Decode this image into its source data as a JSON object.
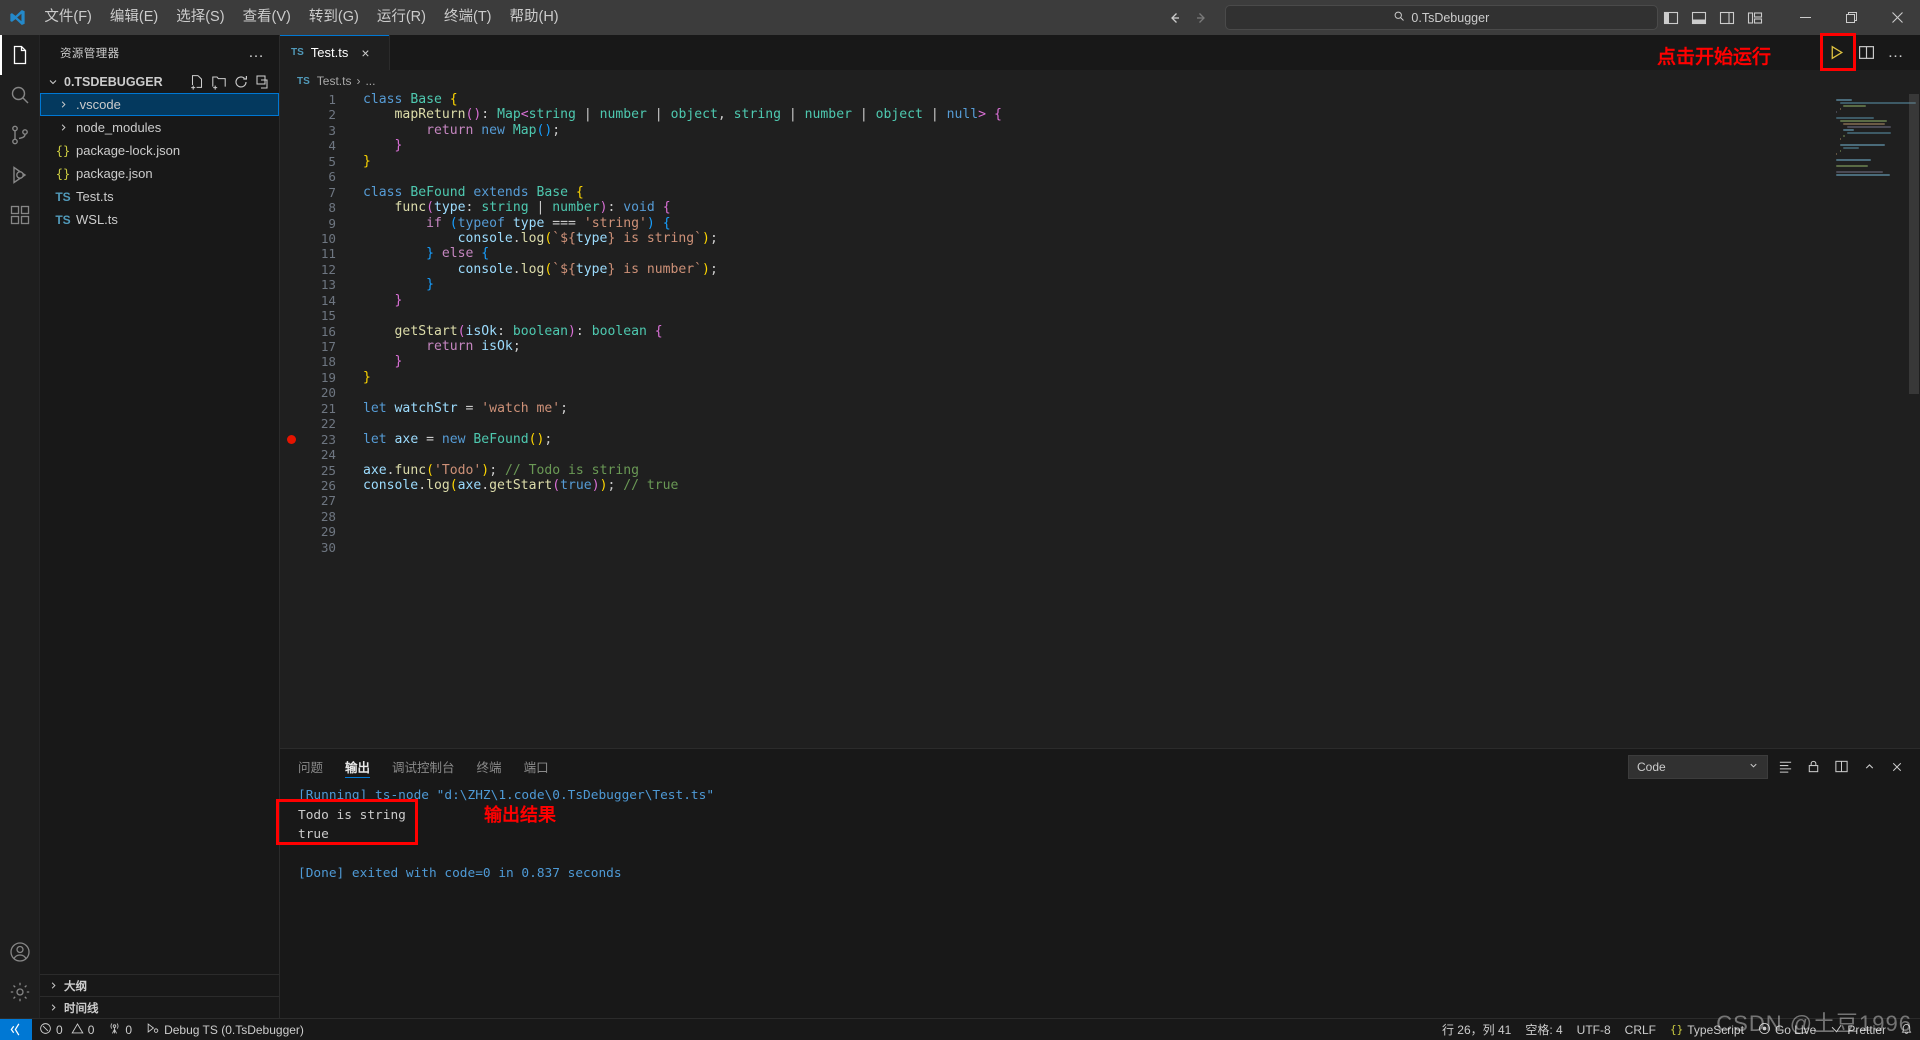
{
  "titlebar": {
    "menus": [
      "文件(F)",
      "编辑(E)",
      "选择(S)",
      "查看(V)",
      "转到(G)",
      "运行(R)",
      "终端(T)",
      "帮助(H)"
    ],
    "command_center_text": "0.TsDebugger",
    "search_icon": "search-icon",
    "back_icon": "arrow-left-icon",
    "forward_icon": "arrow-right-icon",
    "layout_icons": [
      "toggle-primary-sidebar-icon",
      "toggle-panel-icon",
      "toggle-secondary-sidebar-icon",
      "customize-layout-icon"
    ],
    "window_buttons": [
      "minimize",
      "restore",
      "close"
    ]
  },
  "activitybar": {
    "items": [
      {
        "name": "explorer",
        "icon": "files-icon",
        "active": true
      },
      {
        "name": "search",
        "icon": "search-icon",
        "active": false
      },
      {
        "name": "source-control",
        "icon": "source-control-icon",
        "active": false
      },
      {
        "name": "run-and-debug",
        "icon": "debug-icon",
        "active": false
      },
      {
        "name": "extensions",
        "icon": "extensions-icon",
        "active": false
      }
    ],
    "bottom": [
      {
        "name": "accounts",
        "icon": "account-icon"
      },
      {
        "name": "manage",
        "icon": "gear-icon"
      }
    ]
  },
  "sidebar": {
    "title": "资源管理器",
    "more_actions": "…",
    "root": {
      "label": "0.TSDEBUGGER",
      "actions": [
        "new-file-icon",
        "new-folder-icon",
        "refresh-icon",
        "collapse-all-icon"
      ]
    },
    "tree": [
      {
        "label": ".vscode",
        "type": "folder",
        "selected": true
      },
      {
        "label": "node_modules",
        "type": "folder",
        "selected": false
      },
      {
        "label": "package-lock.json",
        "type": "json",
        "selected": false
      },
      {
        "label": "package.json",
        "type": "json",
        "selected": false
      },
      {
        "label": "Test.ts",
        "type": "ts",
        "selected": false
      },
      {
        "label": "WSL.ts",
        "type": "ts",
        "selected": false
      }
    ],
    "sections": [
      "大纲",
      "时间线"
    ]
  },
  "editor": {
    "tab": {
      "label": "Test.ts",
      "icon": "ts-file-icon",
      "close": "×"
    },
    "breadcrumb": {
      "file": "Test.ts",
      "separator": "›",
      "rest": "..."
    },
    "actions": [
      "run-code-button",
      "split-editor-icon",
      "more-actions-icon"
    ],
    "annotation_run": "点击开始运行",
    "lines": [
      {
        "n": 1,
        "bp": false,
        "html": "<span class=\"t-kw\">class</span> <span class=\"t-type\">Base</span> <span class=\"t-y\">{</span>"
      },
      {
        "n": 2,
        "bp": false,
        "html": "    <span class=\"t-fn\">mapReturn</span><span class=\"t-p\">(</span><span class=\"t-p\">)</span><span class=\"t-punc\">:</span> <span class=\"t-type\">Map</span><span class=\"t-p\">&lt;</span><span class=\"t-type\">string</span> <span class=\"t-punc\">|</span> <span class=\"t-type\">number</span> <span class=\"t-punc\">|</span> <span class=\"t-type\">object</span><span class=\"t-punc\">,</span> <span class=\"t-type\">string</span> <span class=\"t-punc\">|</span> <span class=\"t-type\">number</span> <span class=\"t-punc\">|</span> <span class=\"t-type\">object</span> <span class=\"t-punc\">|</span> <span class=\"t-kw\">null</span><span class=\"t-p\">&gt;</span> <span class=\"t-p\">{</span>"
      },
      {
        "n": 3,
        "bp": false,
        "html": "        <span class=\"t-ctl\">return</span> <span class=\"t-kw\">new</span> <span class=\"t-type\">Map</span><span class=\"t-b\">(</span><span class=\"t-b\">)</span><span class=\"t-punc\">;</span>"
      },
      {
        "n": 4,
        "bp": false,
        "html": "    <span class=\"t-p\">}</span>"
      },
      {
        "n": 5,
        "bp": false,
        "html": "<span class=\"t-y\">}</span>"
      },
      {
        "n": 6,
        "bp": false,
        "html": ""
      },
      {
        "n": 7,
        "bp": false,
        "html": "<span class=\"t-kw\">class</span> <span class=\"t-type\">BeFound</span> <span class=\"t-kw\">extends</span> <span class=\"t-type\">Base</span> <span class=\"t-y\">{</span>"
      },
      {
        "n": 8,
        "bp": false,
        "html": "    <span class=\"t-fn\">func</span><span class=\"t-p\">(</span><span class=\"t-param\">type</span><span class=\"t-punc\">:</span> <span class=\"t-type\">string</span> <span class=\"t-punc\">|</span> <span class=\"t-type\">number</span><span class=\"t-p\">)</span><span class=\"t-punc\">:</span> <span class=\"t-kw\">void</span> <span class=\"t-p\">{</span>"
      },
      {
        "n": 9,
        "bp": false,
        "html": "        <span class=\"t-ctl\">if</span> <span class=\"t-b\">(</span><span class=\"t-kw\">typeof</span> <span class=\"t-var\">type</span> <span class=\"t-punc\">===</span> <span class=\"t-str\">'string'</span><span class=\"t-b\">)</span> <span class=\"t-b\">{</span>"
      },
      {
        "n": 10,
        "bp": false,
        "html": "            <span class=\"t-var\">console</span><span class=\"t-punc\">.</span><span class=\"t-fn\">log</span><span class=\"t-y\">(</span><span class=\"t-str\">`${</span><span class=\"t-var\">type</span><span class=\"t-str\">} is string`</span><span class=\"t-y\">)</span><span class=\"t-punc\">;</span>"
      },
      {
        "n": 11,
        "bp": false,
        "html": "        <span class=\"t-b\">}</span> <span class=\"t-ctl\">else</span> <span class=\"t-b\">{</span>"
      },
      {
        "n": 12,
        "bp": false,
        "html": "            <span class=\"t-var\">console</span><span class=\"t-punc\">.</span><span class=\"t-fn\">log</span><span class=\"t-y\">(</span><span class=\"t-str\">`${</span><span class=\"t-var\">type</span><span class=\"t-str\">} is number`</span><span class=\"t-y\">)</span><span class=\"t-punc\">;</span>"
      },
      {
        "n": 13,
        "bp": false,
        "html": "        <span class=\"t-b\">}</span>"
      },
      {
        "n": 14,
        "bp": false,
        "html": "    <span class=\"t-p\">}</span>"
      },
      {
        "n": 15,
        "bp": false,
        "html": ""
      },
      {
        "n": 16,
        "bp": false,
        "html": "    <span class=\"t-fn\">getStart</span><span class=\"t-p\">(</span><span class=\"t-param\">isOk</span><span class=\"t-punc\">:</span> <span class=\"t-type\">boolean</span><span class=\"t-p\">)</span><span class=\"t-punc\">:</span> <span class=\"t-type\">boolean</span> <span class=\"t-p\">{</span>"
      },
      {
        "n": 17,
        "bp": false,
        "html": "        <span class=\"t-ctl\">return</span> <span class=\"t-var\">isOk</span><span class=\"t-punc\">;</span>"
      },
      {
        "n": 18,
        "bp": false,
        "html": "    <span class=\"t-p\">}</span>"
      },
      {
        "n": 19,
        "bp": false,
        "html": "<span class=\"t-y\">}</span>"
      },
      {
        "n": 20,
        "bp": false,
        "html": ""
      },
      {
        "n": 21,
        "bp": false,
        "html": "<span class=\"t-kw\">let</span> <span class=\"t-var\">watchStr</span> <span class=\"t-punc\">=</span> <span class=\"t-str\">'watch me'</span><span class=\"t-punc\">;</span>"
      },
      {
        "n": 22,
        "bp": false,
        "html": ""
      },
      {
        "n": 23,
        "bp": true,
        "html": "<span class=\"t-kw\">let</span> <span class=\"t-var\">axe</span> <span class=\"t-punc\">=</span> <span class=\"t-kw\">new</span> <span class=\"t-type\">BeFound</span><span class=\"t-y\">(</span><span class=\"t-y\">)</span><span class=\"t-punc\">;</span>"
      },
      {
        "n": 24,
        "bp": false,
        "html": ""
      },
      {
        "n": 25,
        "bp": false,
        "html": "<span class=\"t-var\">axe</span><span class=\"t-punc\">.</span><span class=\"t-fn\">func</span><span class=\"t-y\">(</span><span class=\"t-str\">'Todo'</span><span class=\"t-y\">)</span><span class=\"t-punc\">;</span> <span class=\"t-cmt\">// Todo is string</span>"
      },
      {
        "n": 26,
        "bp": false,
        "html": "<span class=\"t-var\">console</span><span class=\"t-punc\">.</span><span class=\"t-fn\">log</span><span class=\"t-y\">(</span><span class=\"t-var\">axe</span><span class=\"t-punc\">.</span><span class=\"t-fn\">getStart</span><span class=\"t-p\">(</span><span class=\"t-kw\">true</span><span class=\"t-p\">)</span><span class=\"t-y\">)</span><span class=\"t-punc\">;</span> <span class=\"t-cmt\">// true</span>"
      },
      {
        "n": 27,
        "bp": false,
        "html": ""
      },
      {
        "n": 28,
        "bp": false,
        "html": ""
      },
      {
        "n": 29,
        "bp": false,
        "html": ""
      },
      {
        "n": 30,
        "bp": false,
        "html": ""
      }
    ]
  },
  "panel": {
    "tabs": [
      {
        "label": "问题",
        "active": false
      },
      {
        "label": "输出",
        "active": true
      },
      {
        "label": "调试控制台",
        "active": false
      },
      {
        "label": "终端",
        "active": false
      },
      {
        "label": "端口",
        "active": false
      }
    ],
    "select_value": "Code",
    "select_chevron": "chevron-down-icon",
    "right_icons": [
      "clear-output-icon",
      "lock-icon",
      "split-icon",
      "chevron-up-icon",
      "close-icon"
    ],
    "output": [
      {
        "text": "[Running] ts-node \"d:\\ZHZ\\1.code\\0.TsDebugger\\Test.ts\"",
        "kind": "running"
      },
      {
        "text": "Todo is string",
        "kind": "plain"
      },
      {
        "text": "true",
        "kind": "plain"
      },
      {
        "text": "",
        "kind": "plain"
      },
      {
        "text": "[Done] exited with code=0 in 0.837 seconds",
        "kind": "done"
      }
    ],
    "annotation_output": "输出结果"
  },
  "statusbar": {
    "remote_icon": "remote-window-icon",
    "errors": "0",
    "warnings": "0",
    "ports": "0",
    "debug_target": "Debug TS (0.TsDebugger)",
    "line_col": "行 26，列 41",
    "spaces": "空格: 4",
    "encoding": "UTF-8",
    "eol": "CRLF",
    "language": "TypeScript",
    "go_live": "Go Live",
    "prettier": "Prettier",
    "bell_icon": "bell-icon"
  },
  "watermark": "CSDN @土豆1996",
  "colors": {
    "accent": "#0078d4",
    "annotation_red": "#ff0000",
    "breakpoint_red": "#e51400",
    "editor_bg": "#1f1f1f",
    "sidebar_bg": "#181818",
    "titlebar_bg": "#3c3c3c"
  }
}
